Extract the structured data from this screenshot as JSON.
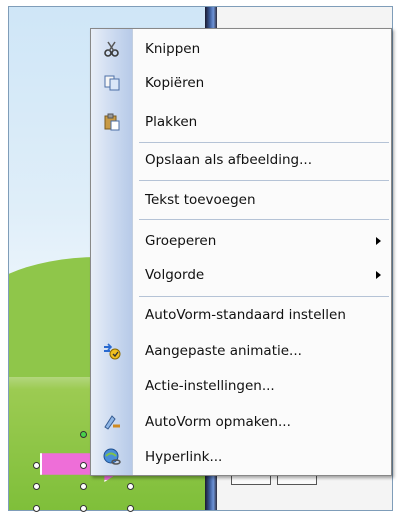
{
  "menu": {
    "items": [
      {
        "id": "knippen",
        "label": "Knippen",
        "icon": "scissors-icon",
        "submenu": false
      },
      {
        "id": "kopieren",
        "label": "Kopiëren",
        "icon": "copy-icon",
        "submenu": false
      },
      {
        "id": "plakken",
        "label": "Plakken",
        "icon": "paste-icon",
        "submenu": false
      },
      {
        "id": "opslaan",
        "label": "Opslaan als afbeelding...",
        "icon": "",
        "submenu": false
      },
      {
        "id": "tekst",
        "label": "Tekst toevoegen",
        "icon": "",
        "submenu": false
      },
      {
        "id": "groeperen",
        "label": "Groeperen",
        "icon": "",
        "submenu": true
      },
      {
        "id": "volgorde",
        "label": "Volgorde",
        "icon": "",
        "submenu": true
      },
      {
        "id": "autovorm-standaard",
        "label": "AutoVorm-standaard instellen",
        "icon": "",
        "submenu": false
      },
      {
        "id": "animatie",
        "label": "Aangepaste animatie...",
        "icon": "animation-icon",
        "submenu": false
      },
      {
        "id": "actie",
        "label": "Actie-instellingen...",
        "icon": "",
        "submenu": false
      },
      {
        "id": "autovorm-opmaken",
        "label": "AutoVorm opmaken...",
        "icon": "format-shape-icon",
        "submenu": false
      },
      {
        "id": "hyperlink",
        "label": "Hyperlink...",
        "icon": "hyperlink-icon",
        "submenu": false
      }
    ]
  },
  "colors": {
    "shape_fill": "#ee6ed8",
    "menu_bg": "#fbfbfb",
    "gutter": "#c9d8ef"
  }
}
